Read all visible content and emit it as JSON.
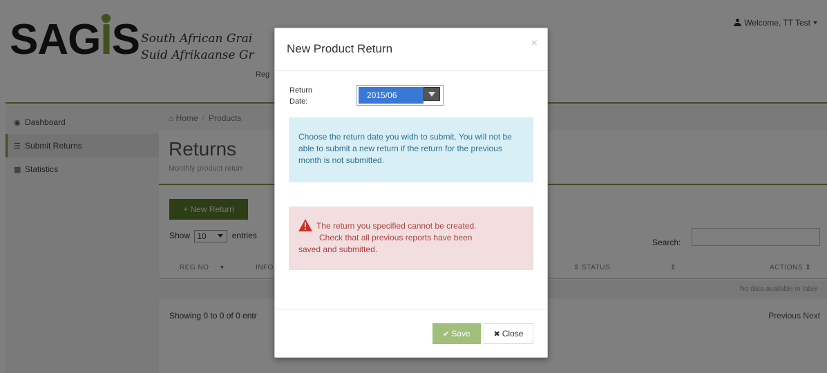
{
  "header": {
    "logo_left": "SAG",
    "logo_i": "I",
    "logo_right": "S",
    "org_line_1": "South African Grai",
    "org_line_2": "Suid Afrikaanse Gr",
    "org_line_3": "Reg",
    "welcome": "Welcome, TT Test"
  },
  "sidebar": {
    "items": [
      {
        "label": "Dashboard",
        "icon": "dashboard-icon"
      },
      {
        "label": "Submit Returns",
        "icon": "list-icon"
      },
      {
        "label": "Statistics",
        "icon": "chart-icon"
      }
    ]
  },
  "breadcrumb": {
    "home": "Home",
    "products": "Products"
  },
  "main": {
    "title": "Returns",
    "subtitle": "Monthly product returr",
    "new_button": "New Return",
    "show_label": "Show",
    "show_value": "10",
    "entries_label": "entries",
    "search_label": "Search:",
    "columns": [
      "REG NO",
      "INFO F",
      "STATUS",
      "ACTIONS"
    ],
    "empty_text": "No data available in table",
    "info": "Showing 0 to 0 of 0 entr",
    "pager": "Previous Next"
  },
  "modal": {
    "title": "New Product Return",
    "close_glyph": "×",
    "date_label_1": "Return",
    "date_label_2": "Date:",
    "date_value": "2015/06",
    "info_text": "Choose the return date you widh to submit. You will not be able to submit a new return if the return for the previous month is not submitted.",
    "error_line_1": "The return you specified cannot be created.",
    "error_line_2": "Check that all previous reports have been",
    "error_line_3": "saved and submitted.",
    "save_label": "Save",
    "close_label": "Close"
  },
  "colors": {
    "brand_green": "#7fa33b",
    "button_green": "#5b7a2c",
    "info_bg": "#d8eff6",
    "danger_bg": "#f2dede"
  }
}
